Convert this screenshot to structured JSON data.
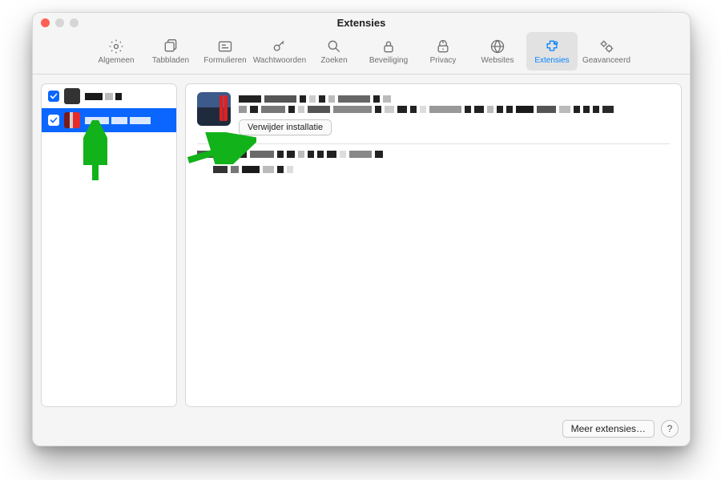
{
  "window": {
    "title": "Extensies"
  },
  "toolbar": {
    "items": [
      {
        "id": "algemeen",
        "label": "Algemeen"
      },
      {
        "id": "tabbladen",
        "label": "Tabbladen"
      },
      {
        "id": "formulieren",
        "label": "Formulieren"
      },
      {
        "id": "wachtwoorden",
        "label": "Wachtwoorden"
      },
      {
        "id": "zoeken",
        "label": "Zoeken"
      },
      {
        "id": "beveiliging",
        "label": "Beveiliging"
      },
      {
        "id": "privacy",
        "label": "Privacy"
      },
      {
        "id": "websites",
        "label": "Websites"
      },
      {
        "id": "extensies",
        "label": "Extensies",
        "active": true
      },
      {
        "id": "geavanceerd",
        "label": "Geavanceerd"
      }
    ]
  },
  "detail": {
    "uninstall_label": "Verwijder installatie"
  },
  "footer": {
    "more_label": "Meer extensies…",
    "help_label": "?"
  },
  "annotation": {
    "arrow_color": "#12b21a"
  }
}
